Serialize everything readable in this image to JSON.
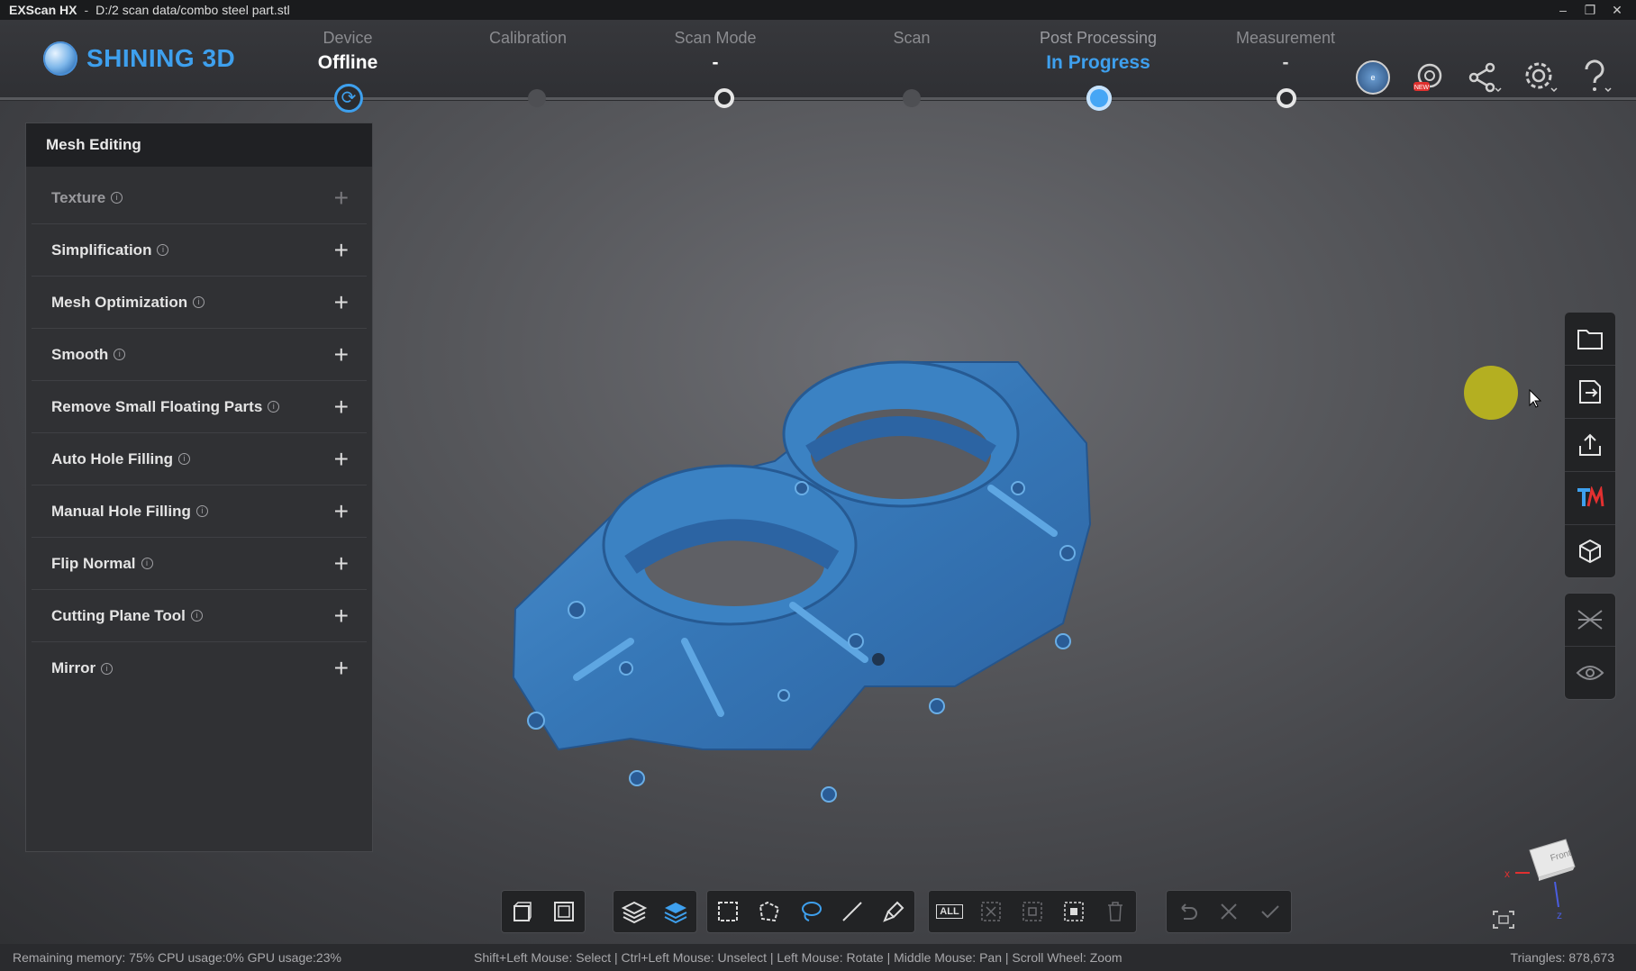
{
  "window": {
    "app_name": "EXScan HX",
    "separator": "-",
    "file_path": "D:/2 scan data/combo steel  part.stl",
    "controls": [
      "–",
      "❐",
      "✕"
    ]
  },
  "brand": {
    "name": "SHINING 3D"
  },
  "steps": [
    {
      "label": "Device",
      "value": "Offline"
    },
    {
      "label": "Calibration",
      "value": ""
    },
    {
      "label": "Scan Mode",
      "value": "-"
    },
    {
      "label": "Scan",
      "value": ""
    },
    {
      "label": "Post Processing",
      "value": "In Progress"
    },
    {
      "label": "Measurement",
      "value": "-"
    }
  ],
  "header_icons": [
    "model-icon",
    "new-feature-icon",
    "share-icon",
    "settings-icon",
    "help-icon"
  ],
  "panel": {
    "title": "Mesh Editing",
    "items": [
      {
        "label": "Texture",
        "enabled": false
      },
      {
        "label": "Simplification",
        "enabled": true
      },
      {
        "label": "Mesh Optimization",
        "enabled": true
      },
      {
        "label": "Smooth",
        "enabled": true
      },
      {
        "label": "Remove Small Floating Parts",
        "enabled": true
      },
      {
        "label": "Auto Hole Filling",
        "enabled": true
      },
      {
        "label": "Manual Hole Filling",
        "enabled": true
      },
      {
        "label": "Flip Normal",
        "enabled": true
      },
      {
        "label": "Cutting Plane Tool",
        "enabled": true
      },
      {
        "label": "Mirror",
        "enabled": true
      }
    ]
  },
  "bottom_toolbar": {
    "select_all_label": "ALL"
  },
  "orientation_cube": {
    "face_label": "Front",
    "axis_x": "x",
    "axis_z": "z"
  },
  "status": {
    "system": "Remaining memory: 75% CPU usage:0%  GPU usage:23%",
    "hints": "Shift+Left Mouse: Select | Ctrl+Left Mouse: Unselect | Left Mouse: Rotate | Middle Mouse: Pan | Scroll Wheel: Zoom",
    "triangles": "Triangles: 878,673"
  },
  "colors": {
    "accent": "#3ea0ee",
    "mesh": "#3b7fc0",
    "highlight_dot": "#b9b41f"
  }
}
